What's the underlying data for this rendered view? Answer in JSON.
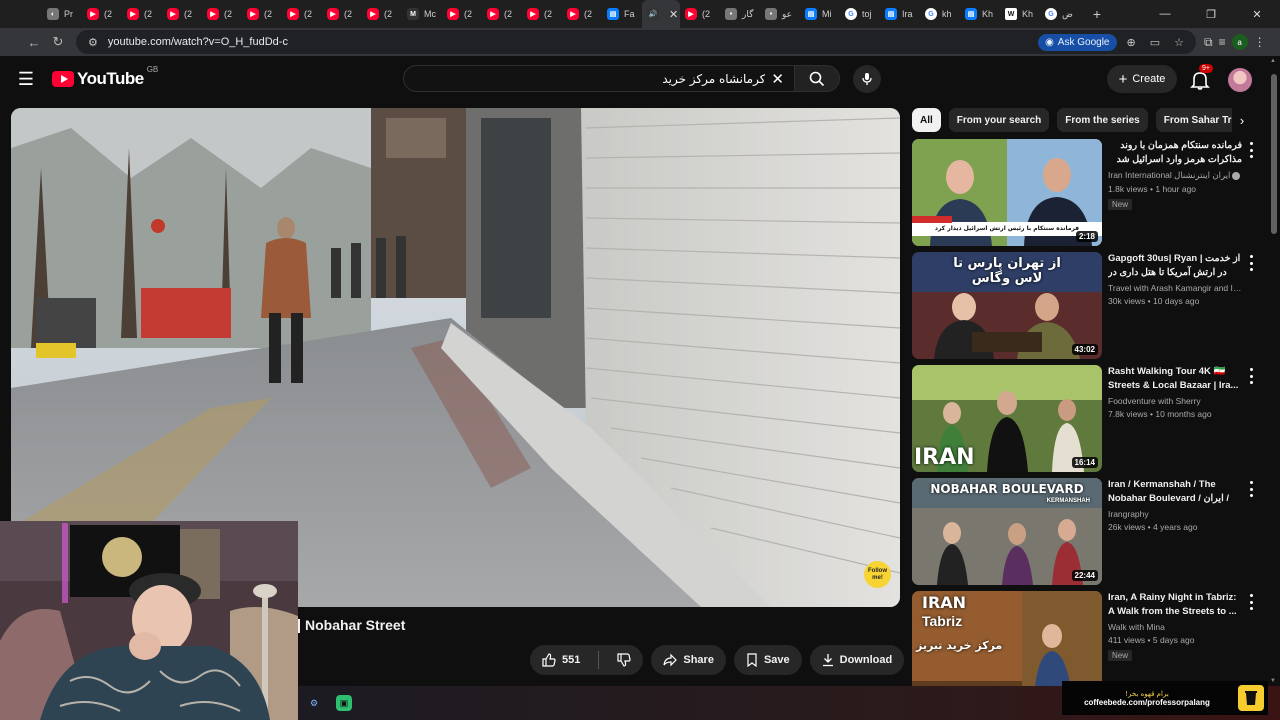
{
  "browser": {
    "tabs": [
      {
        "label": "Pr",
        "favicon": "photo",
        "active": false
      },
      {
        "label": "(2",
        "favicon": "youtube",
        "active": false
      },
      {
        "label": "(2",
        "favicon": "youtube",
        "active": false
      },
      {
        "label": "(2",
        "favicon": "youtube",
        "active": false
      },
      {
        "label": "(2",
        "favicon": "youtube",
        "active": false
      },
      {
        "label": "(2",
        "favicon": "youtube",
        "active": false
      },
      {
        "label": "(2",
        "favicon": "youtube",
        "active": false
      },
      {
        "label": "(2",
        "favicon": "youtube",
        "active": false
      },
      {
        "label": "(2",
        "favicon": "youtube",
        "active": false
      },
      {
        "label": "Mc",
        "favicon": "dark",
        "active": false
      },
      {
        "label": "(2",
        "favicon": "youtube",
        "active": false
      },
      {
        "label": "(2",
        "favicon": "youtube",
        "active": false
      },
      {
        "label": "(2",
        "favicon": "youtube",
        "active": false
      },
      {
        "label": "(2",
        "favicon": "youtube",
        "active": false
      },
      {
        "label": "Fa",
        "favicon": "doc",
        "active": false
      },
      {
        "label": "",
        "favicon": "audio",
        "active": true
      },
      {
        "label": "(2",
        "favicon": "youtube",
        "active": false
      },
      {
        "label": "گار",
        "favicon": "gray",
        "active": false
      },
      {
        "label": "عو",
        "favicon": "gray",
        "active": false
      },
      {
        "label": "Mi",
        "favicon": "doc",
        "active": false
      },
      {
        "label": "toj",
        "favicon": "google",
        "active": false
      },
      {
        "label": "Ira",
        "favicon": "doc",
        "active": false
      },
      {
        "label": "kh",
        "favicon": "google",
        "active": false
      },
      {
        "label": "Kh",
        "favicon": "doc",
        "active": false
      },
      {
        "label": "Kh",
        "favicon": "wiki",
        "active": false
      },
      {
        "label": "ض",
        "favicon": "google",
        "active": false
      }
    ],
    "url": "youtube.com/watch?v=O_H_fudDd-c",
    "ask_google": "Ask Google",
    "profile_letter": "a"
  },
  "youtube": {
    "logo_word": "YouTube",
    "region": "GB",
    "search_value": "کرمانشاه مرکز خرید",
    "create_label": "Create",
    "notif_count": "9+",
    "video_title": "Nobahar Street",
    "like_count": "551",
    "share_label": "Share",
    "save_label": "Save",
    "download_label": "Download",
    "watermark_text": "Follow me!",
    "chips": [
      "All",
      "From your search",
      "From the series",
      "From Sahar Tr"
    ],
    "recommendations": [
      {
        "title": "فرمانده سنتکام همزمان با روند مذاکرات هرمز وارد اسرائیل شد",
        "channel": "Iran International ایران اینترنشنال",
        "verified": true,
        "stats": "1.8k views • 1 hour ago",
        "badge": "New",
        "duration": "2:18",
        "theme": "news",
        "thumb_caption": "فرمانده سنتکام با رئیس ارتش اسرائیل دیدار کرد"
      },
      {
        "title": "Gapgoft 30us| Ryan | از خدمت در ارتش آمریکا تا هتل داری در لاس ...",
        "channel": "Travel with Arash Kamangir and Imm...",
        "verified": false,
        "stats": "30k views • 10 days ago",
        "badge": "",
        "duration": "43:02",
        "theme": "talk",
        "thumb_caption": "از تهران پارس تا لاس وگاس"
      },
      {
        "title": "Rasht Walking Tour 4K 🇮🇷 Streets & Local Bazaar | Ira...",
        "channel": "Foodventure with Sherry",
        "verified": false,
        "stats": "7.8k views • 10 months ago",
        "badge": "",
        "duration": "16:14",
        "theme": "iran",
        "thumb_caption": "IRAN"
      },
      {
        "title": "Iran / Kermanshah / The Nobahar Boulevard / ایران /",
        "channel": "Irangraphy",
        "verified": false,
        "stats": "26k views • 4 years ago",
        "badge": "",
        "duration": "22:44",
        "theme": "nobahar",
        "thumb_caption": "NOBAHAR BOULEVARD",
        "thumb_subcaption": "KERMANSHAH"
      },
      {
        "title": "Iran, A Rainy Night in Tabriz: A Walk from the Streets to ...",
        "channel": "Walk with Mina",
        "verified": false,
        "stats": "411 views • 5 days ago",
        "badge": "New",
        "duration": "",
        "theme": "tabriz",
        "thumb_caption": "IRAN",
        "thumb_subcaption": "Tabriz",
        "thumb_footer": "مرکز خرید تبریز"
      }
    ]
  },
  "overlay": {
    "coffee_line1": "برام قهوه بخر!",
    "coffee_line2": "coffeebede.com/professorpalang"
  }
}
